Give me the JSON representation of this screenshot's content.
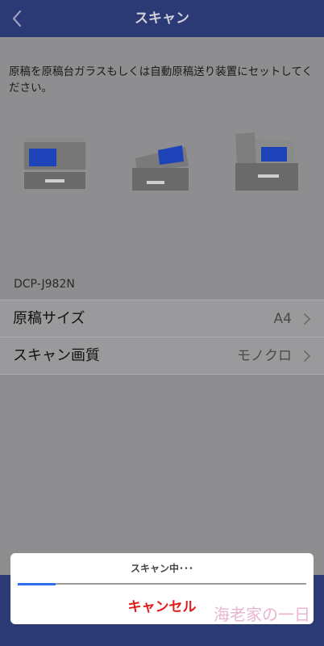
{
  "nav": {
    "title": "スキャン",
    "back_icon": "chevron-left-icon"
  },
  "instruction": "原稿を原稿台ガラスもしくは自動原稿送り装置にセットしてください。",
  "device_name": "DCP-J982N",
  "settings": [
    {
      "label": "原稿サイズ",
      "value": "A4"
    },
    {
      "label": "スキャン画質",
      "value": "モノクロ"
    }
  ],
  "dialog": {
    "message": "スキャン中･･･",
    "progress": 0.13,
    "cancel_label": "キャンセル"
  },
  "watermark": "海老家の一日",
  "colors": {
    "nav_bar": "#2b3a74",
    "overlay_bg": "#8e8e91",
    "accent_blue": "#2e6cf0",
    "cancel_red": "#e21b1b",
    "scanner_gray": "#6e6e6e",
    "scanner_glass": "#1e43b8"
  }
}
